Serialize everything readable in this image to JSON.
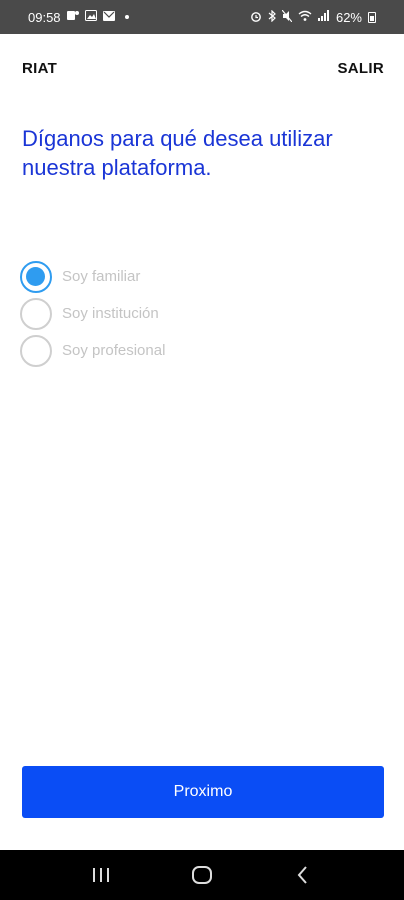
{
  "status_bar": {
    "time": "09:58",
    "battery": "62%",
    "left_icons": [
      "teams-icon",
      "image-icon",
      "mail-icon",
      "dot-icon"
    ],
    "right_icons": [
      "alarm-icon",
      "bluetooth-icon",
      "mute-icon",
      "wifi-icon",
      "signal-icon",
      "battery-icon"
    ]
  },
  "header": {
    "brand": "RIAT",
    "exit_label": "SALIR"
  },
  "main": {
    "title": "Díganos para qué desea utilizar nuestra plataforma.",
    "options": [
      {
        "label": "Soy familiar",
        "selected": true
      },
      {
        "label": "Soy institución",
        "selected": false
      },
      {
        "label": "Soy profesional",
        "selected": false
      }
    ],
    "next_label": "Proximo"
  },
  "colors": {
    "title": "#1a35d6",
    "button": "#0a4df5",
    "radio_selected": "#2f9cf0"
  }
}
